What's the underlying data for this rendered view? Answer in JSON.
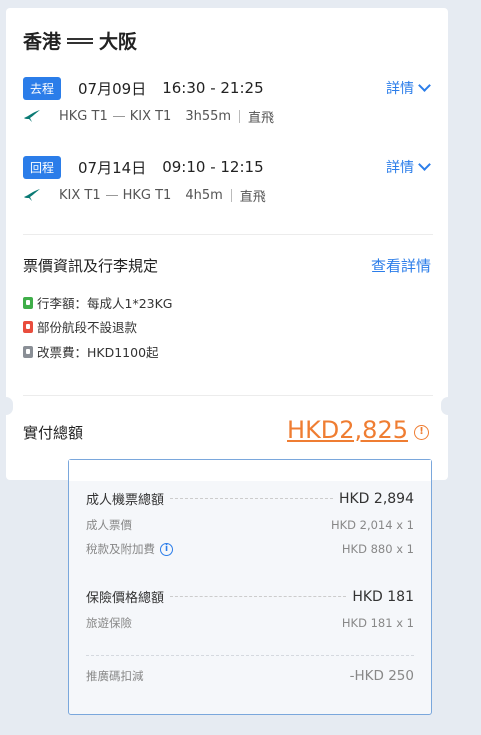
{
  "header": {
    "origin": "香港",
    "destination": "大阪"
  },
  "legs": [
    {
      "badge": "去程",
      "date": "07月09日",
      "time": "16:30 - 21:25",
      "detail_label": "詳情",
      "route_from": "HKG T1",
      "route_to": "KIX T1",
      "duration": "3h55m",
      "type": "直飛"
    },
    {
      "badge": "回程",
      "date": "07月14日",
      "time": "09:10 - 12:15",
      "detail_label": "詳情",
      "route_from": "KIX T1",
      "route_to": "HKG T1",
      "duration": "4h5m",
      "type": "直飛"
    }
  ],
  "policy": {
    "title": "票價資訊及行李規定",
    "link": "查看詳情",
    "items": [
      "行李額：每成人1*23KG",
      "部份航段不設退款",
      "改票費：HKD1100起"
    ]
  },
  "total": {
    "label": "實付總額",
    "value": "HKD2,825",
    "info": "!"
  },
  "breakdown": {
    "adult_total_label": "成人機票總額",
    "adult_total_value": "HKD 2,894",
    "adult_fare_label": "成人票價",
    "adult_fare_value": "HKD 2,014 x 1",
    "tax_label": "稅款及附加費",
    "tax_info": "i",
    "tax_value": "HKD 880 x 1",
    "insurance_total_label": "保險價格總額",
    "insurance_total_value": "HKD 181",
    "travel_insurance_label": "旅遊保險",
    "travel_insurance_value": "HKD 181 x 1",
    "promo_label": "推廣碼扣減",
    "promo_value": "-HKD 250"
  },
  "colors": {
    "accent": "#2b7de9",
    "price": "#ef7d32",
    "baggage": "#3fae49",
    "refund": "#e94d3d"
  }
}
